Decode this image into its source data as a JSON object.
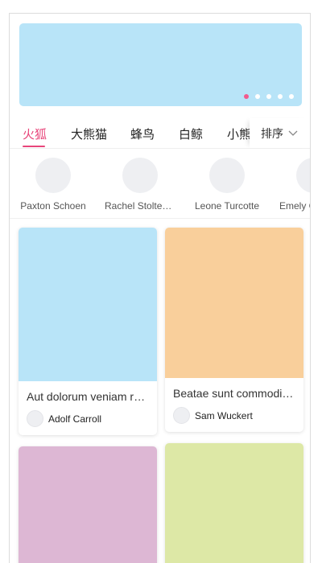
{
  "banner": {
    "color": "#b8e4f8",
    "slides": 5,
    "active_index": 0
  },
  "tabs": {
    "items": [
      {
        "label": "火狐",
        "active": true
      },
      {
        "label": "大熊猫",
        "active": false
      },
      {
        "label": "蜂鸟",
        "active": false
      },
      {
        "label": "白鲸",
        "active": false
      },
      {
        "label": "小熊",
        "active": false
      }
    ],
    "sort_label": "排序",
    "accent_color": "#e8457a"
  },
  "users": [
    {
      "name": "Paxton Schoen"
    },
    {
      "name": "Rachel Stoltenberg"
    },
    {
      "name": "Leone Turcotte"
    },
    {
      "name": "Emely G"
    }
  ],
  "cards": [
    {
      "title": "Aut dolorum veniam rem",
      "author": "Adolf Carroll",
      "color": "#b8e4f8"
    },
    {
      "title": "Beatae sunt commodi qui",
      "author": "Sam Wuckert",
      "color": "#f9cf9b"
    },
    {
      "title": "",
      "author": "",
      "color": "#ddb7d4"
    },
    {
      "title": "",
      "author": "",
      "color": "#dde8a6"
    }
  ]
}
